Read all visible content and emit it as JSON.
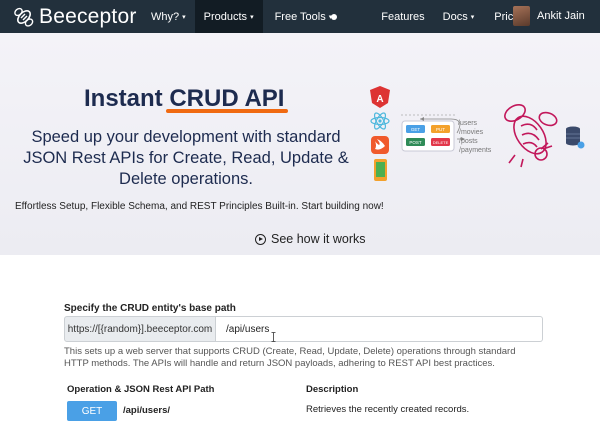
{
  "nav": {
    "brand": "Beeceptor",
    "items": [
      {
        "label": "Why?",
        "caret": "▾"
      },
      {
        "label": "Products",
        "caret": "▾",
        "active": true
      },
      {
        "label": "Free Tools",
        "caret": "▾"
      },
      {
        "label": "Features",
        "caret": ""
      },
      {
        "label": "Docs",
        "caret": "▾"
      },
      {
        "label": "Pricing",
        "caret": ""
      }
    ],
    "user_name": "Ankit Jain"
  },
  "hero": {
    "title_prefix": "Instant ",
    "title_highlight": "CRUD API",
    "subtitle": "Speed up your development with standard JSON Rest APIs for Create, Read, Update & Delete operations.",
    "tagline": "Effortless Setup, Flexible Schema, and REST Principles Built-in. Start building now!",
    "cta": "See how it works",
    "illustration": {
      "methods": [
        "GET",
        "PUT",
        "POST",
        "DELETE"
      ],
      "paths": [
        "/users",
        "/movies",
        "/posts",
        "/payments"
      ]
    }
  },
  "form": {
    "label": "Specify the CRUD entity's base path",
    "prefix": "https://[{random}].beeceptor.com",
    "value": "/api/users",
    "description": "This sets up a web server that supports CRUD (Create, Read, Update, Delete) operations through standard HTTP methods. The APIs will handle and return JSON payloads, adhering to REST API best practices."
  },
  "table": {
    "col_path": "Operation & JSON Rest API Path",
    "col_desc": "Description",
    "rows": [
      {
        "method": "GET",
        "path": "/api/users/",
        "description": "Retrieves the recently created records."
      }
    ]
  },
  "colors": {
    "navbar": "#22303c",
    "accent": "#f06a12",
    "get": "#4aa0e6",
    "bee": "#c2185b"
  }
}
